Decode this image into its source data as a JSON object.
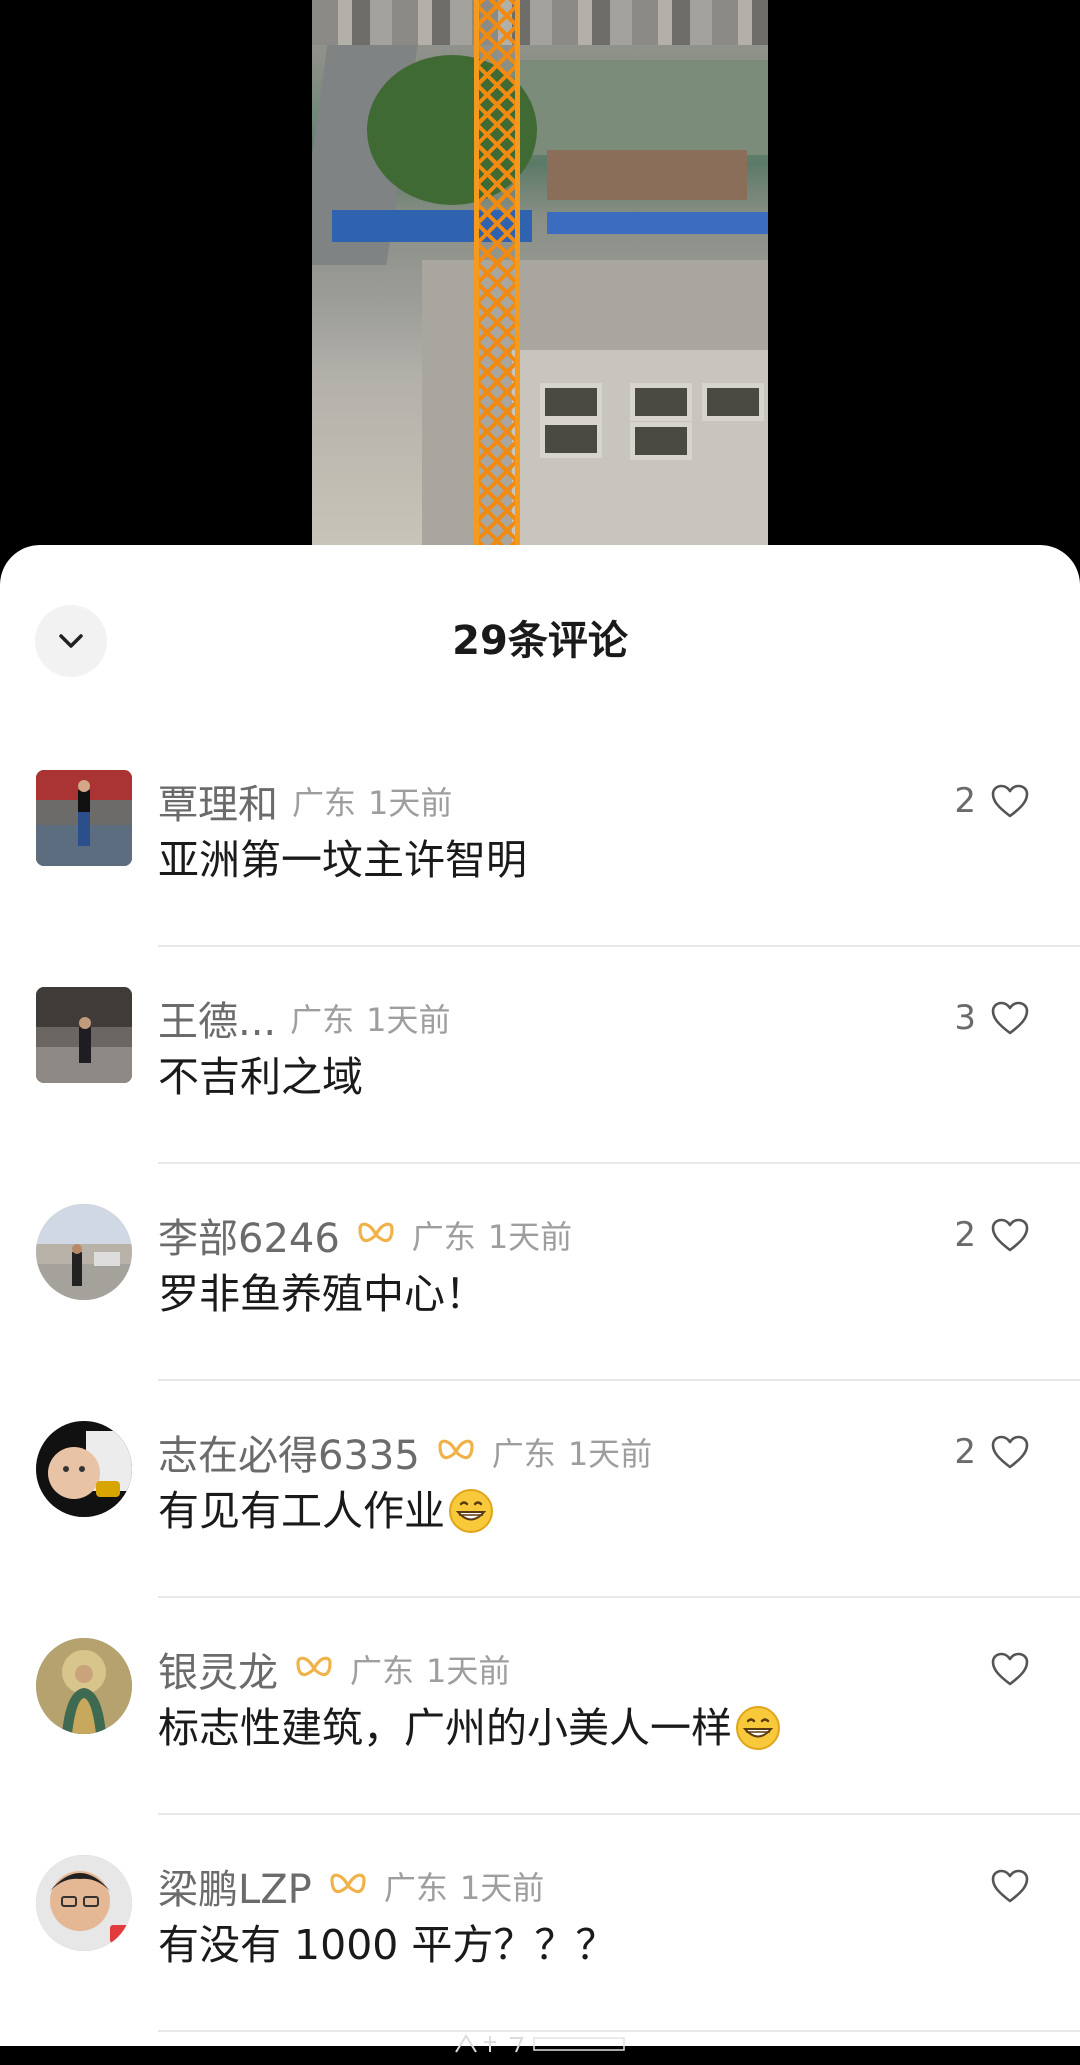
{
  "sheet": {
    "title": "29条评论",
    "collapse_icon": "chevron-down-icon"
  },
  "comments": [
    {
      "username": "覃理和",
      "badge": false,
      "location": "广东",
      "time": "1天前",
      "text": "亚洲第一坟主许智明",
      "emoji": false,
      "likes": "2"
    },
    {
      "username": "王德...",
      "badge": false,
      "location": "广东",
      "time": "1天前",
      "text": "不吉利之域",
      "emoji": false,
      "likes": "3"
    },
    {
      "username": "李部6246",
      "badge": true,
      "location": "广东",
      "time": "1天前",
      "text": "罗非鱼养殖中心！",
      "emoji": false,
      "likes": "2"
    },
    {
      "username": "志在必得6335",
      "badge": true,
      "location": "广东",
      "time": "1天前",
      "text": "有见有工人作业",
      "emoji": true,
      "likes": "2"
    },
    {
      "username": "银灵龙",
      "badge": true,
      "location": "广东",
      "time": "1天前",
      "text": "标志性建筑，广州的小美人一样",
      "emoji": true,
      "likes": ""
    },
    {
      "username": "梁鹏LZP",
      "badge": true,
      "location": "广东",
      "time": "1天前",
      "text": "有没有 1000 平方？？？",
      "emoji": false,
      "likes": ""
    }
  ],
  "colors": {
    "badge_gold": "#f0b24a",
    "text_primary": "#1a1a1a",
    "text_secondary": "#6b6b6b",
    "text_meta": "#9e9e9e"
  }
}
